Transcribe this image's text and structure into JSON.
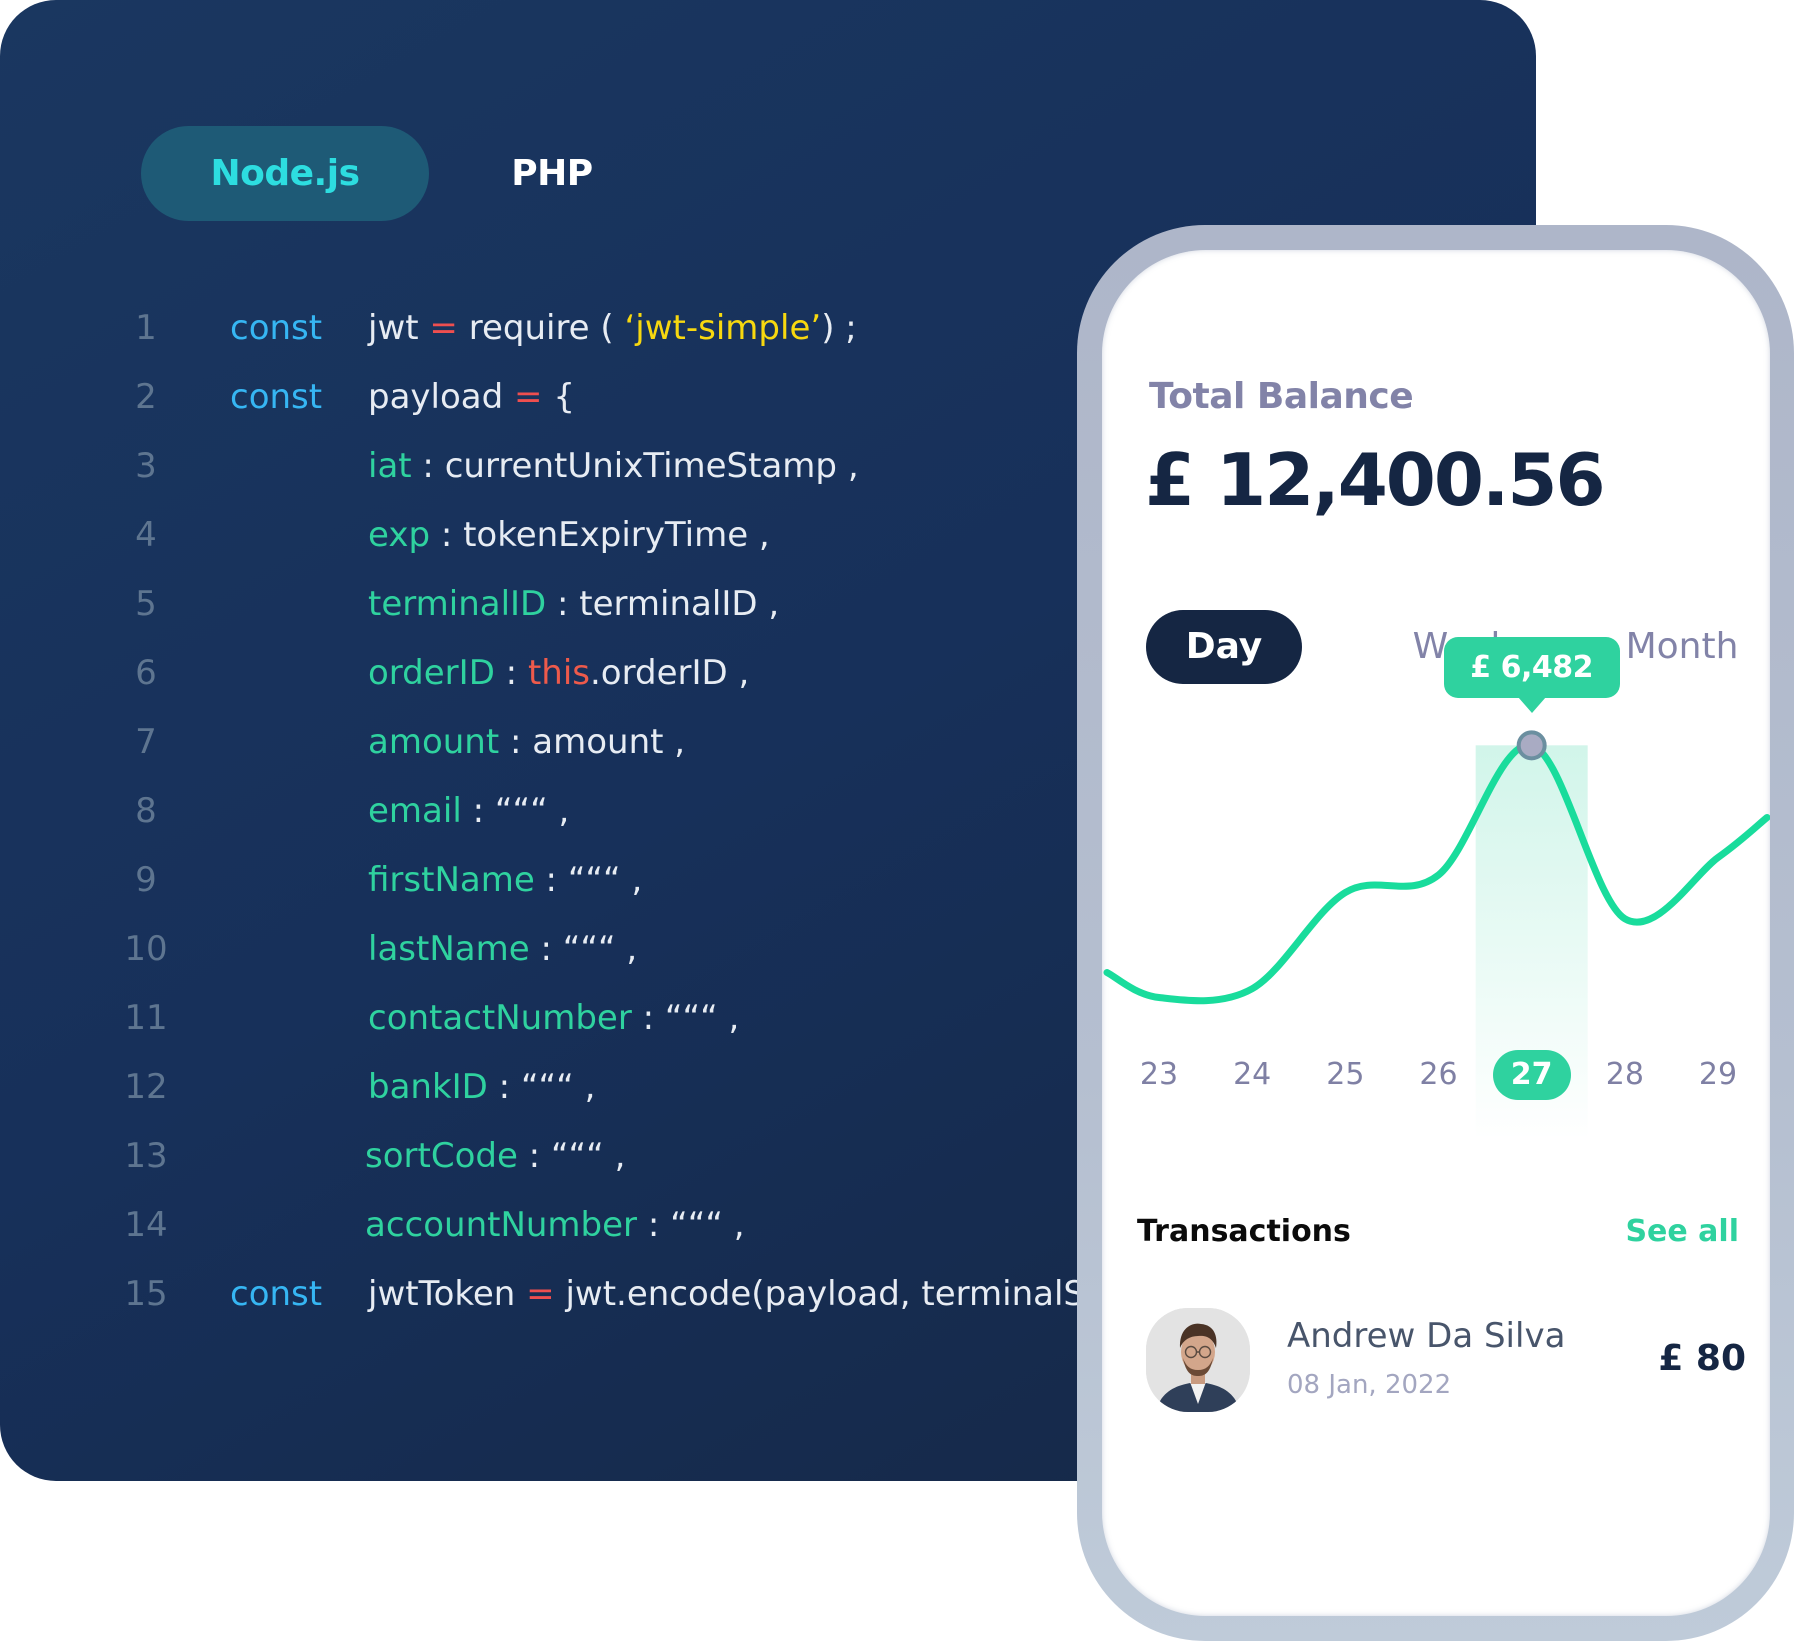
{
  "code_panel": {
    "tabs": [
      {
        "label": "Node.js",
        "active": true
      },
      {
        "label": "PHP",
        "active": false
      }
    ],
    "lines": [
      {
        "n": "1",
        "kw": "const",
        "tokens": [
          [
            "plain",
            "jwt "
          ],
          [
            "op",
            "="
          ],
          [
            "plain",
            " require ( "
          ],
          [
            "str",
            "‘jwt-simple’"
          ],
          [
            "plain",
            ") ;"
          ]
        ]
      },
      {
        "n": "2",
        "kw": "const",
        "tokens": [
          [
            "plain",
            "payload "
          ],
          [
            "op",
            "="
          ],
          [
            "plain",
            " {"
          ]
        ]
      },
      {
        "n": "3",
        "kw": "",
        "tokens": [
          [
            "key",
            "iat"
          ],
          [
            "plain",
            " :  currentUnixTimeStamp ,"
          ]
        ]
      },
      {
        "n": "4",
        "kw": "",
        "tokens": [
          [
            "key",
            "exp"
          ],
          [
            "plain",
            " :  tokenExpiryTime ,"
          ]
        ]
      },
      {
        "n": "5",
        "kw": "",
        "tokens": [
          [
            "key",
            "terminalID"
          ],
          [
            "plain",
            " :  terminalID ,"
          ]
        ]
      },
      {
        "n": "6",
        "kw": "",
        "tokens": [
          [
            "key",
            "orderID"
          ],
          [
            "plain",
            " :  "
          ],
          [
            "this",
            "this"
          ],
          [
            "plain",
            ".orderID ,"
          ]
        ]
      },
      {
        "n": "7",
        "kw": "",
        "tokens": [
          [
            "key",
            "amount"
          ],
          [
            "plain",
            " :  amount ,"
          ]
        ]
      },
      {
        "n": "8",
        "kw": "",
        "tokens": [
          [
            "key",
            "email"
          ],
          [
            "plain",
            " :  “““ ,"
          ]
        ]
      },
      {
        "n": "9",
        "kw": "",
        "tokens": [
          [
            "key",
            "firstName"
          ],
          [
            "plain",
            " :  “““ ,"
          ]
        ]
      },
      {
        "n": "10",
        "kw": "",
        "tokens": [
          [
            "key",
            "lastName"
          ],
          [
            "plain",
            " :  “““ ,"
          ]
        ]
      },
      {
        "n": "11",
        "kw": "",
        "tokens": [
          [
            "key",
            "contactNumber"
          ],
          [
            "plain",
            " :  “““ ,"
          ]
        ]
      },
      {
        "n": "12",
        "kw": "",
        "tokens": [
          [
            "key",
            "bankID"
          ],
          [
            "plain",
            " :  “““ ,"
          ]
        ]
      },
      {
        "n": "13",
        "kw": "",
        "tokens": [
          [
            "key",
            "sortCode"
          ],
          [
            "plain",
            " :  “““ ,"
          ]
        ]
      },
      {
        "n": "14",
        "kw": "",
        "tokens": [
          [
            "key",
            "accountNumber"
          ],
          [
            "plain",
            " :  “““ ,"
          ]
        ]
      },
      {
        "n": "15",
        "kw": "const",
        "tokens": [
          [
            "plain",
            "jwtToken "
          ],
          [
            "op",
            "="
          ],
          [
            "plain",
            " jwt.encode(payload, terminalSecret)"
          ]
        ]
      }
    ]
  },
  "phone": {
    "balance_label": "Total Balance",
    "balance_amount": "£ 12,400.56",
    "periods": [
      {
        "label": "Day",
        "active": true
      },
      {
        "label": "Week",
        "active": false
      },
      {
        "label": "Month",
        "active": false
      }
    ],
    "transactions_title": "Transactions",
    "see_all": "See all",
    "transactions": [
      {
        "name": "Andrew Da Silva",
        "date": "08 Jan, 2022",
        "amount": "£ 80",
        "avatar": "person-photo"
      }
    ]
  },
  "colors": {
    "accent_green": "#2fd29f",
    "navy": "#152643",
    "code_bg": "#17305a",
    "keyword_blue": "#36b6f3",
    "string_yellow": "#f7d80f",
    "operator_red": "#ee4f4f"
  },
  "chart_data": {
    "type": "line",
    "title": "",
    "xlabel": "",
    "ylabel": "",
    "categories": [
      "23",
      "24",
      "25",
      "26",
      "27",
      "28",
      "29"
    ],
    "selected_category": "27",
    "tooltip": "£ 6,482",
    "series": [
      {
        "name": "Balance",
        "values": [
          3600,
          3700,
          4800,
          5000,
          6482,
          4500,
          5200
        ]
      }
    ],
    "ylim": [
      3000,
      7000
    ],
    "grid": false,
    "legend": "none"
  }
}
